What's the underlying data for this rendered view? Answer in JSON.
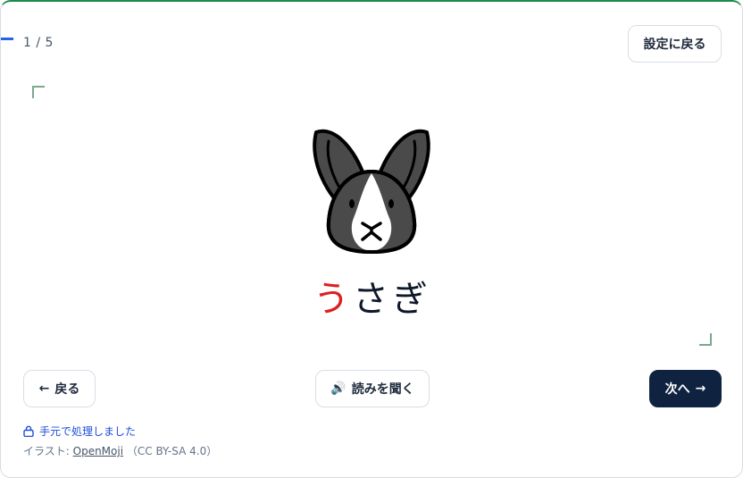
{
  "progress": {
    "counter": "1 / 5",
    "fraction": 0.2
  },
  "header": {
    "settings_label": "設定に戻る"
  },
  "card": {
    "word_first": "う",
    "word_rest": "さぎ",
    "image_icon": "rabbit-face-icon"
  },
  "nav": {
    "back_label": "戻る",
    "back_icon": "←",
    "listen_label": "読みを聞く",
    "listen_icon": "🔊",
    "next_label": "次へ",
    "next_icon": "→"
  },
  "footer": {
    "local_note": "手元で処理しました",
    "credit_prefix": "イラスト: ",
    "credit_link": "OpenMoji",
    "credit_license": "（CC BY-SA 4.0）"
  },
  "colors": {
    "accent": "#0f2340",
    "highlight": "#dc1f1f",
    "link": "#1d4ed8",
    "top_border": "#1f8a4c"
  }
}
